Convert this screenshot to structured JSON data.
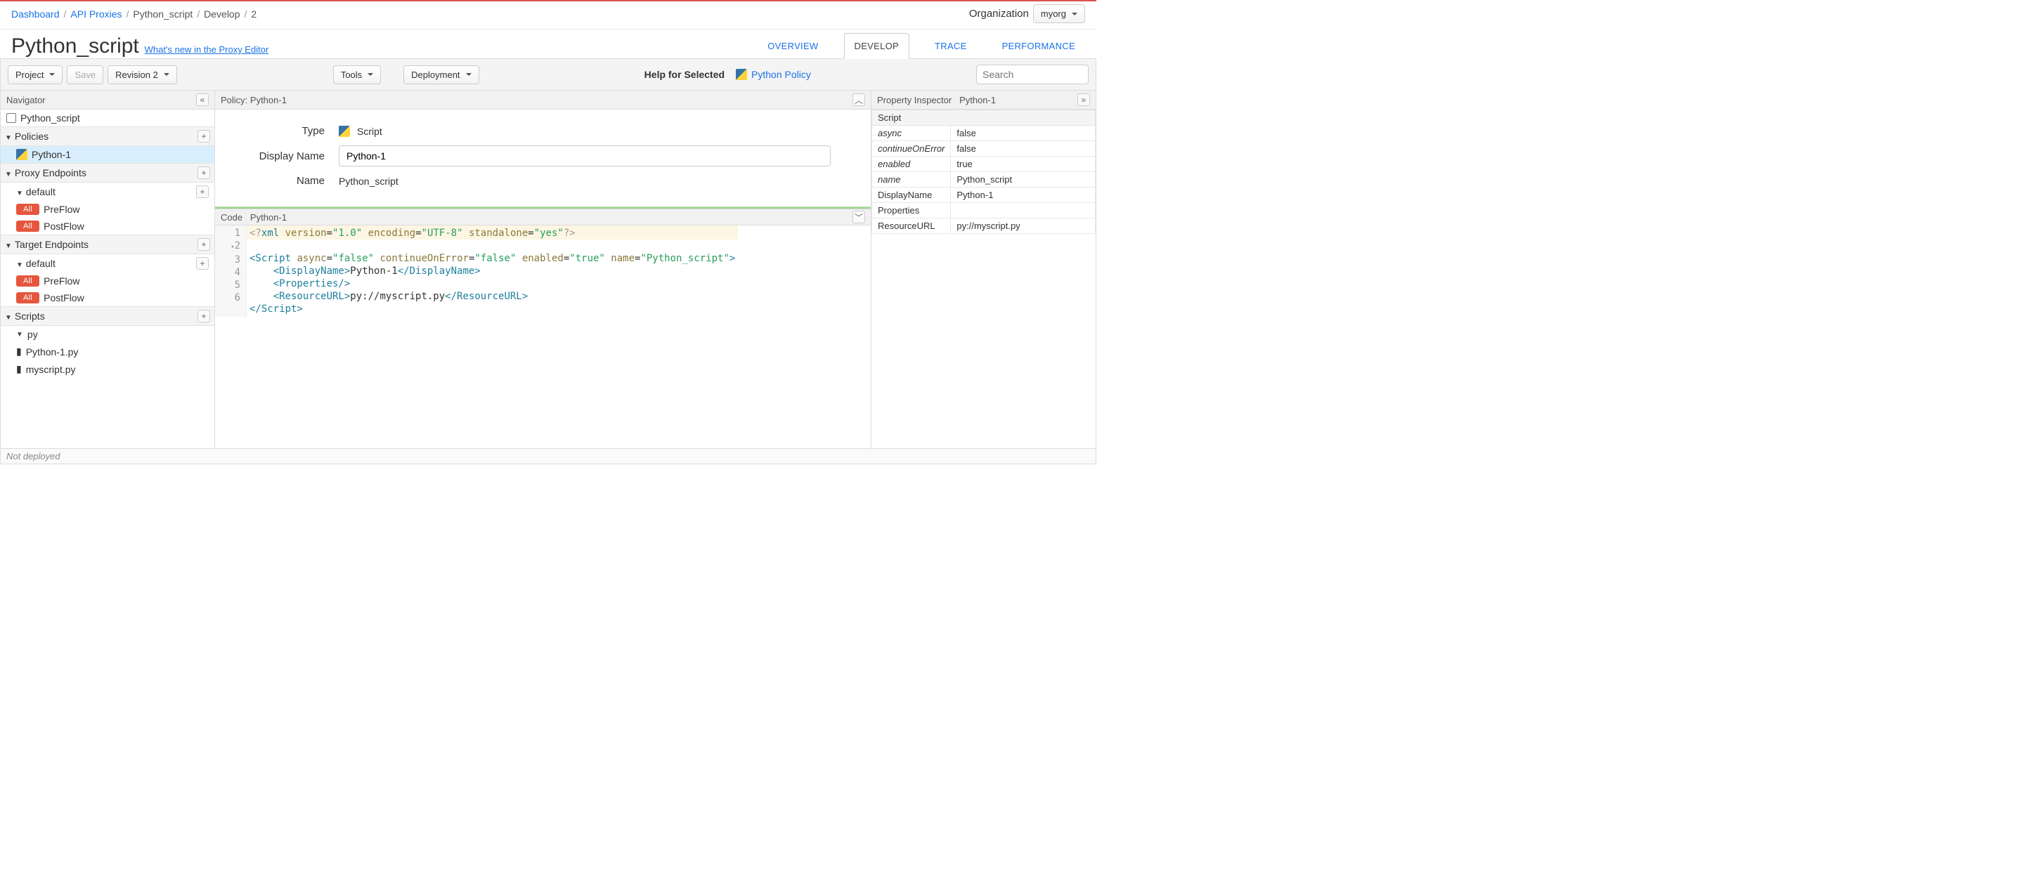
{
  "breadcrumbs": {
    "dashboard": "Dashboard",
    "proxies": "API Proxies",
    "proxy": "Python_script",
    "section": "Develop",
    "rev": "2"
  },
  "org": {
    "label": "Organization",
    "selected": "myorg"
  },
  "page": {
    "title": "Python_script",
    "whatsnew": "What's new in the Proxy Editor"
  },
  "tabs": {
    "overview": "OVERVIEW",
    "develop": "DEVELOP",
    "trace": "TRACE",
    "performance": "PERFORMANCE",
    "active": "DEVELOP"
  },
  "toolbar": {
    "project": "Project",
    "save": "Save",
    "revision": "Revision 2",
    "tools": "Tools",
    "deployment": "Deployment",
    "help_label": "Help for Selected",
    "policy_link": "Python Policy",
    "search_placeholder": "Search"
  },
  "navigator": {
    "title": "Navigator",
    "root": "Python_script",
    "policies": {
      "label": "Policies",
      "items": [
        "Python-1"
      ],
      "selected": "Python-1"
    },
    "proxy_endpoints": {
      "label": "Proxy Endpoints",
      "default": {
        "label": "default",
        "flows": [
          "PreFlow",
          "PostFlow"
        ]
      }
    },
    "target_endpoints": {
      "label": "Target Endpoints",
      "default": {
        "label": "default",
        "flows": [
          "PreFlow",
          "PostFlow"
        ]
      }
    },
    "scripts": {
      "label": "Scripts",
      "groups": {
        "py": [
          "Python-1.py",
          "myscript.py"
        ]
      }
    },
    "all_badge": "All"
  },
  "policy_panel": {
    "title": "Policy: Python-1",
    "type_label": "Type",
    "type_value": "Script",
    "display_name_label": "Display Name",
    "display_name_value": "Python-1",
    "name_label": "Name",
    "name_value": "Python_script"
  },
  "code_panel": {
    "label": "Code",
    "file": "Python-1",
    "xml": {
      "version": "1.0",
      "encoding": "UTF-8",
      "standalone": "yes",
      "root": "Script",
      "attrs": {
        "async": "false",
        "continueOnError": "false",
        "enabled": "true",
        "name": "Python_script"
      },
      "DisplayName": "Python-1",
      "ResourceURL": "py://myscript.py"
    }
  },
  "inspector": {
    "title": "Property Inspector",
    "subject": "Python-1",
    "group": "Script",
    "rows": [
      {
        "k": "async",
        "v": "false",
        "italic": true
      },
      {
        "k": "continueOnError",
        "v": "false",
        "italic": true
      },
      {
        "k": "enabled",
        "v": "true",
        "italic": true
      },
      {
        "k": "name",
        "v": "Python_script",
        "italic": true
      },
      {
        "k": "DisplayName",
        "v": "Python-1",
        "italic": false
      },
      {
        "k": "Properties",
        "v": "",
        "italic": false
      },
      {
        "k": "ResourceURL",
        "v": "py://myscript.py",
        "italic": false
      }
    ]
  },
  "status": {
    "deploy": "Not deployed"
  }
}
